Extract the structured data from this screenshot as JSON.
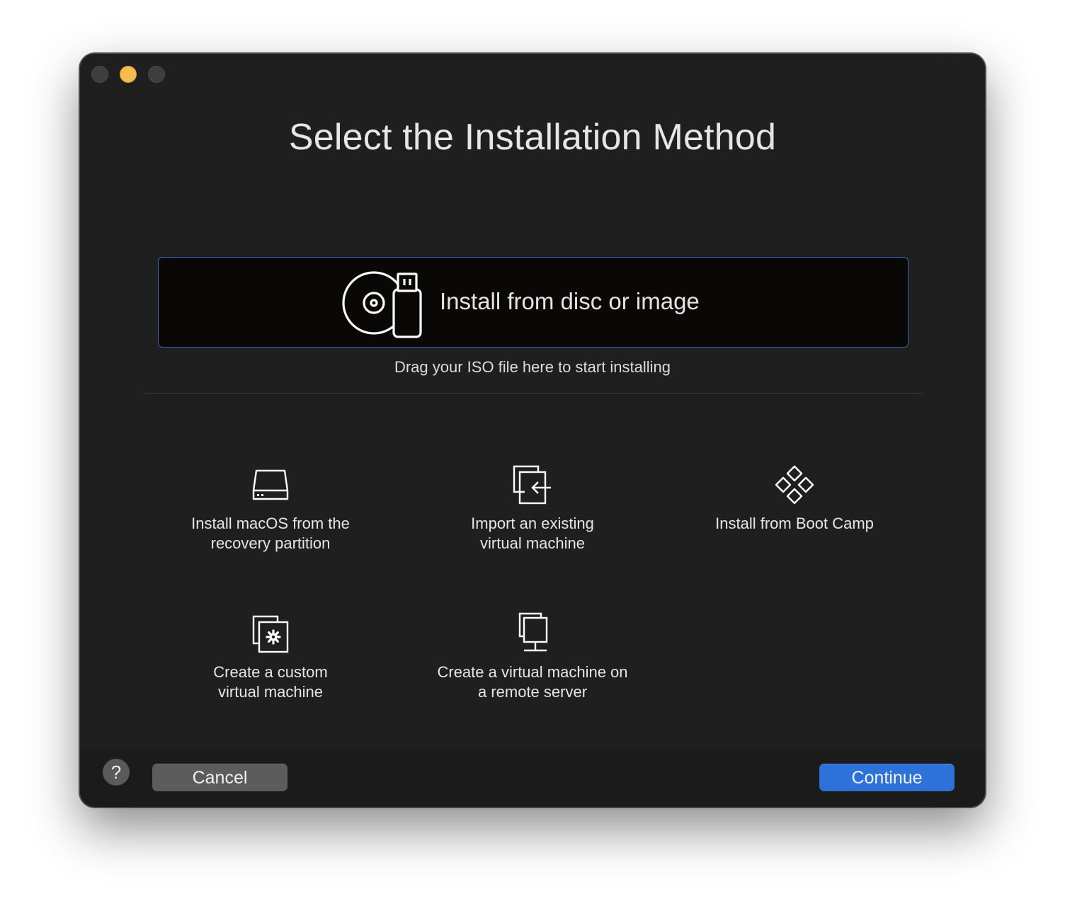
{
  "window": {
    "traffic_lights": [
      "close",
      "minimize",
      "zoom"
    ]
  },
  "title": "Select the Installation Method",
  "drop_zone": {
    "label": "Install from disc or image",
    "icon": "disc-usb-icon",
    "hint": "Drag your ISO file here to start installing"
  },
  "options": [
    {
      "id": "recovery",
      "icon": "hard-drive-icon",
      "label": "Install macOS from the\nrecovery partition"
    },
    {
      "id": "import",
      "icon": "import-vm-icon",
      "label": "Import an existing\nvirtual machine"
    },
    {
      "id": "bootcamp",
      "icon": "boot-camp-icon",
      "label": "Install from Boot Camp"
    },
    {
      "id": "custom",
      "icon": "custom-vm-gear-icon",
      "label": "Create a custom\nvirtual machine"
    },
    {
      "id": "remote",
      "icon": "remote-server-icon",
      "label": "Create a virtual machine on\na remote server"
    }
  ],
  "footer": {
    "help_label": "?",
    "cancel_label": "Cancel",
    "continue_label": "Continue"
  },
  "colors": {
    "window_bg": "#1f1f1f",
    "drop_zone_bg": "#0a0807",
    "drop_zone_border": "#3f5fb8",
    "accent": "#2c72d9",
    "minimize": "#f5bd4f"
  }
}
